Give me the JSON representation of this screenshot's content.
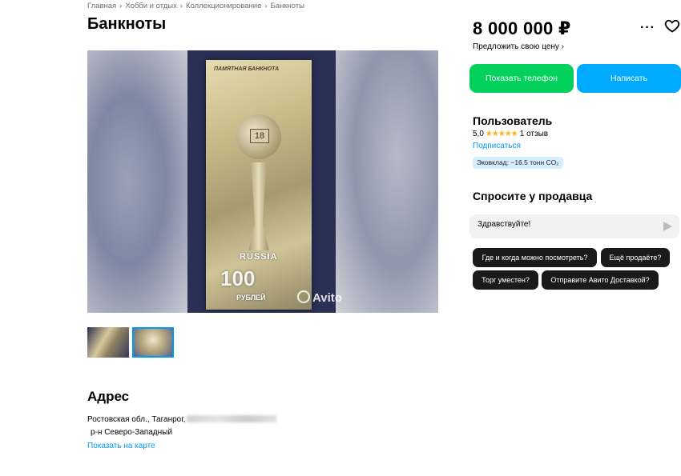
{
  "breadcrumb": [
    "Главная",
    "Хобби и отдых",
    "Коллекционирование",
    "Банкноты"
  ],
  "breadcrumb_sep": "›",
  "title": "Банкноты",
  "photo": {
    "banknote_heading": "ПАМЯТНАЯ БАНКНОТА",
    "ball_number": "18",
    "country": "RUSSIA",
    "denomination": "100",
    "currency": "РУБЛЕЙ",
    "watermark": "Avito"
  },
  "address": {
    "heading": "Адрес",
    "line1": "Ростовская обл., Таганрог,",
    "line2": "р-н Северо-Западный",
    "map_link": "Показать на карте"
  },
  "price": "8 000 000 ₽",
  "offer_price_link": "Предложить свою цену ›",
  "buttons": {
    "show_phone": "Показать телефон",
    "write": "Написать"
  },
  "seller": {
    "name": "Пользователь",
    "rating": "5,0",
    "stars": "★★★★★",
    "reviews": "1 отзыв",
    "subscribe": "Подписаться",
    "eco": "Эковклад: −16.5 тонн CO₂"
  },
  "ask": {
    "heading": "Спросите у продавца",
    "message_value": "Здравствуйте!",
    "chips": [
      "Где и когда можно посмотреть?",
      "Ещё продаёте?",
      "Торг уместен?",
      "Отправите Авито Доставкой?"
    ]
  },
  "icons": [
    "more-dots-icon",
    "heart-icon",
    "send-icon",
    "camera-icon"
  ],
  "colors": {
    "green_button": "#02d15c",
    "blue_button": "#00aaff",
    "link": "#0099f7",
    "star": "#ffb021"
  }
}
